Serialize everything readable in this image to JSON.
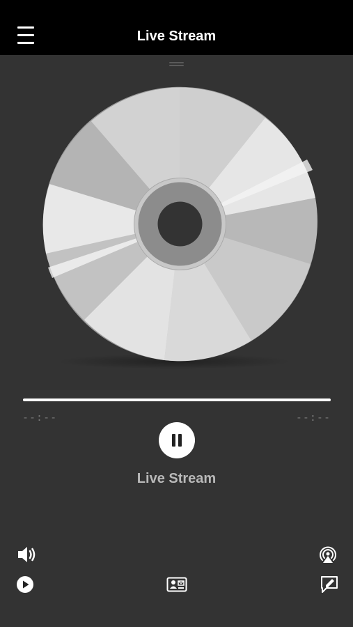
{
  "header": {
    "title": "Live Stream",
    "menu_icon": "hamburger-icon"
  },
  "player": {
    "artwork_icon": "cd-disc",
    "elapsed": "--:--",
    "remaining": "--:--",
    "progress_fraction": 1.0,
    "state": "playing",
    "pause_icon": "pause-icon",
    "track_title": "Live Stream"
  },
  "bottom_controls": {
    "left_top": "volume-icon",
    "left_bottom": "play-circle-icon",
    "center": "contact-card-icon",
    "right_top": "airplay-icon",
    "right_bottom": "message-edit-icon"
  },
  "colors": {
    "background": "#333333",
    "topbar": "#000000",
    "accent": "#ffffff",
    "muted_text": "#777777",
    "title_text": "#b9b9b9"
  }
}
